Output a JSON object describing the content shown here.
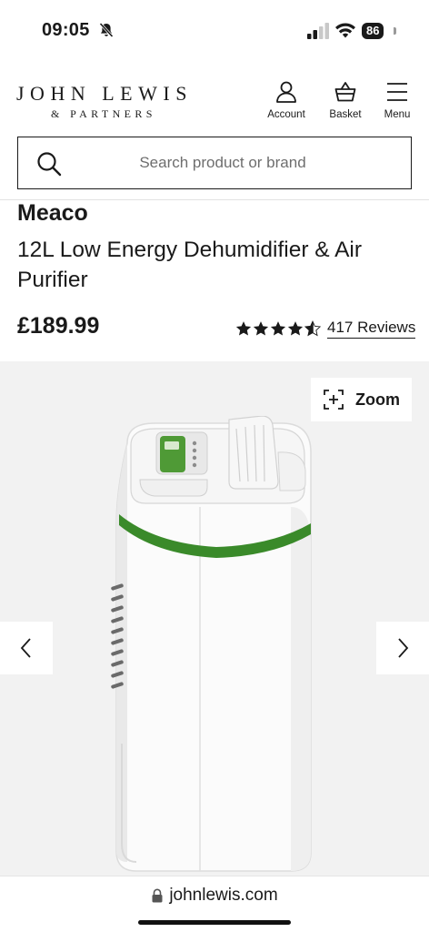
{
  "status_bar": {
    "time": "09:05",
    "battery": "86"
  },
  "header": {
    "logo_main": "JOHN LEWIS",
    "logo_sub": "& PARTNERS",
    "nav": {
      "account": "Account",
      "basket": "Basket",
      "menu": "Menu"
    }
  },
  "search": {
    "placeholder": "Search product or brand"
  },
  "product": {
    "brand": "Meaco",
    "title": "12L Low Energy Dehumidifier & Air Purifier",
    "price": "£189.99",
    "rating_value": 4.5,
    "reviews_label": "417 Reviews"
  },
  "gallery": {
    "zoom_label": "Zoom",
    "accent_color": "#3a8a2a"
  },
  "browser": {
    "url": "johnlewis.com"
  }
}
